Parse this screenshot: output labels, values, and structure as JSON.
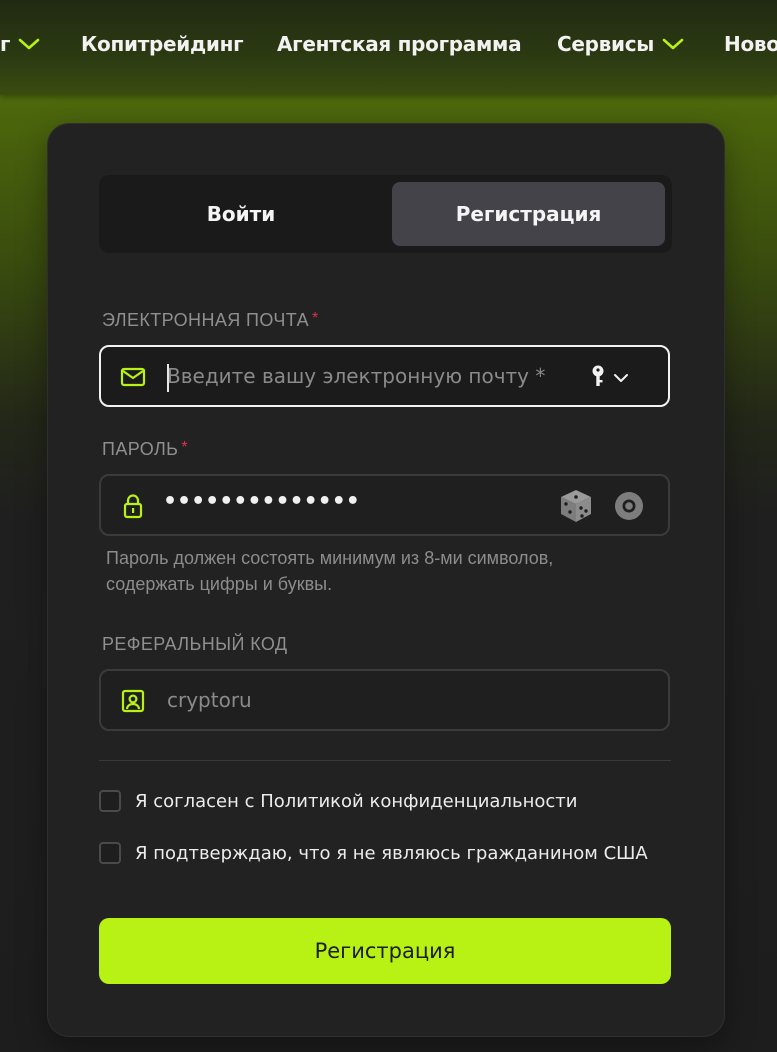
{
  "nav": {
    "items": [
      {
        "label": "г"
      },
      {
        "label": "Копитрейдинг"
      },
      {
        "label": "Агентская программа"
      },
      {
        "label": "Сервисы"
      },
      {
        "label": "Ново"
      }
    ]
  },
  "auth": {
    "tabs": {
      "login": "Войти",
      "register": "Регистрация",
      "active": "register"
    },
    "email": {
      "label": "ЭЛЕКТРОННАЯ ПОЧТА",
      "required_mark": "*",
      "placeholder": "Введите вашу электронную почту *",
      "value": "",
      "icon": "envelope-icon",
      "extra_icon": "key-icon"
    },
    "password": {
      "label": "ПАРОЛЬ",
      "required_mark": "*",
      "masked_value": "••••••••••••••",
      "icon": "lock-icon",
      "generate_icon": "dice-icon",
      "toggle_icon": "eye-icon",
      "hint": "Пароль должен состоять минимум из 8-ми символов, содержать цифры и буквы."
    },
    "referral": {
      "label": "РЕФЕРАЛЬНЫЙ КОД",
      "placeholder": "cryptoru",
      "value": "",
      "icon": "user-badge-icon"
    },
    "checkboxes": [
      {
        "label": "Я согласен с Политикой конфиденциальности",
        "checked": false
      },
      {
        "label": "Я подтверждаю, что я не являюсь гражданином США",
        "checked": false
      }
    ],
    "submit_label": "Регистрация"
  },
  "colors": {
    "accent": "#b8f214",
    "card": "#222222",
    "required": "#e0334a"
  }
}
